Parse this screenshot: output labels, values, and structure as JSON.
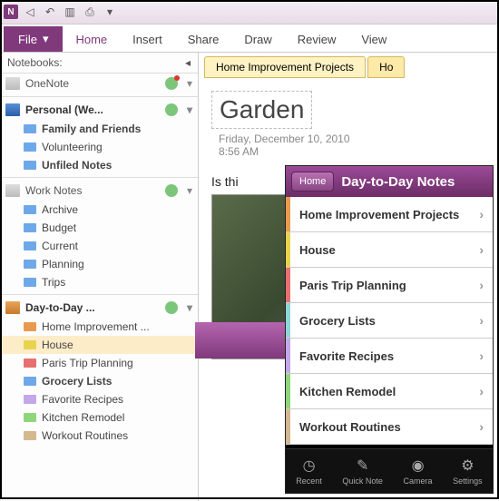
{
  "titlebar": {
    "app_letter": "N"
  },
  "ribbon": {
    "file": "File",
    "tabs": [
      "Home",
      "Insert",
      "Share",
      "Draw",
      "Review",
      "View"
    ]
  },
  "sidebar": {
    "header": "Notebooks:",
    "onenote": "OneNote",
    "nb1": {
      "title": "Personal (We...",
      "sections": [
        {
          "label": "Family and Friends",
          "bold": true,
          "color": "fblue"
        },
        {
          "label": "Volunteering",
          "bold": false,
          "color": "fblue"
        },
        {
          "label": "Unfiled Notes",
          "bold": true,
          "color": "fblue"
        }
      ]
    },
    "nb2": {
      "title": "Work Notes",
      "sections": [
        {
          "label": "Archive",
          "color": "fblue"
        },
        {
          "label": "Budget",
          "color": "fblue"
        },
        {
          "label": "Current",
          "color": "fblue"
        },
        {
          "label": "Planning",
          "color": "fblue"
        },
        {
          "label": "Trips",
          "color": "fblue"
        }
      ]
    },
    "nb3": {
      "title": "Day-to-Day ...",
      "sections": [
        {
          "label": "Home Improvement ...",
          "color": "forange"
        },
        {
          "label": "House",
          "color": "fyellow",
          "sel": true
        },
        {
          "label": "Paris Trip Planning",
          "color": "fred"
        },
        {
          "label": "Grocery Lists",
          "bold": true,
          "color": "fblue"
        },
        {
          "label": "Favorite Recipes",
          "color": "flav"
        },
        {
          "label": "Kitchen Remodel",
          "color": "fgreen"
        },
        {
          "label": "Workout Routines",
          "color": "ftan"
        }
      ]
    }
  },
  "page": {
    "tab1": "Home Improvement Projects",
    "tab2": "Ho",
    "title": "Garden",
    "date": "Friday, December 10, 2010",
    "time": "8:56 AM",
    "text": "Is thi"
  },
  "mobile": {
    "home": "Home",
    "title": "Day-to-Day Notes",
    "items": [
      {
        "label": "Home Improvement Projects",
        "stripe": "s-orange"
      },
      {
        "label": "House",
        "stripe": "s-yellow"
      },
      {
        "label": "Paris Trip Planning",
        "stripe": "s-red"
      },
      {
        "label": "Grocery Lists",
        "stripe": "s-cyan"
      },
      {
        "label": "Favorite Recipes",
        "stripe": "s-lav"
      },
      {
        "label": "Kitchen Remodel",
        "stripe": "s-green"
      },
      {
        "label": "Workout Routines",
        "stripe": "s-tan"
      }
    ],
    "toolbar": [
      {
        "label": "Recent",
        "icon": "◷"
      },
      {
        "label": "Quick Note",
        "icon": "✎"
      },
      {
        "label": "Camera",
        "icon": "◉"
      },
      {
        "label": "Settings",
        "icon": "⚙"
      }
    ]
  }
}
